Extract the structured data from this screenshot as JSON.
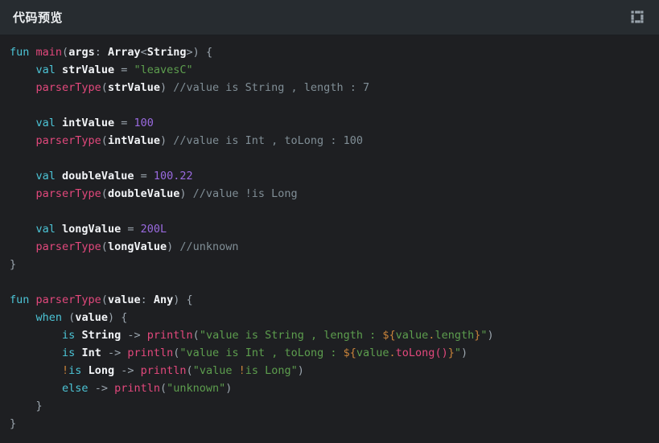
{
  "window": {
    "title": "代码预览",
    "fullscreen_button_label": "compress-arrows",
    "background_color": "#1e1f22",
    "header_background_color": "#272c30"
  },
  "editor": {
    "language": "Kotlin",
    "theme": "dark",
    "colors": {
      "keyword": "#4cc4d6",
      "function": "#e2487c",
      "identifier": "#f2f4f7",
      "number": "#9a6ae0",
      "string": "#5d9e4e",
      "comment": "#808e96",
      "punctuation": "#9aa4ad",
      "template": "#c8833a"
    },
    "lines": [
      "fun main(args: Array<String>) {",
      "    val strValue = \"leavesC\"",
      "    parserType(strValue) //value is String , length : 7",
      "",
      "    val intValue = 100",
      "    parserType(intValue) //value is Int , toLong : 100",
      "",
      "    val doubleValue = 100.22",
      "    parserType(doubleValue) //value !is Long",
      "",
      "    val longValue = 200L",
      "    parserType(longValue) //unknown",
      "}",
      "",
      "fun parserType(value: Any) {",
      "    when (value) {",
      "        is String -> println(\"value is String , length : ${value.length}\")",
      "        is Int -> println(\"value is Int , toLong : ${value.toLong()}\")",
      "        !is Long -> println(\"value !is Long\")",
      "        else -> println(\"unknown\")",
      "    }",
      "}"
    ],
    "tokens": {
      "keywords": [
        "fun",
        "val",
        "when",
        "is",
        "else"
      ],
      "functions": [
        "main",
        "parserType",
        "println",
        "toLong"
      ],
      "types": [
        "Array",
        "String",
        "Int",
        "Long",
        "Any"
      ],
      "identifiers": [
        "args",
        "strValue",
        "intValue",
        "doubleValue",
        "longValue",
        "value"
      ],
      "numbers": [
        "100",
        "100.22",
        "200L",
        "7"
      ],
      "strings": [
        "\"leavesC\"",
        "\"value is String , length : \"",
        "\"value is Int , toLong : \"",
        "\"value !is Long\"",
        "\"unknown\""
      ],
      "comments": [
        "//value is String , length : 7",
        "//value is Int , toLong : 100",
        "//value !is Long",
        "//unknown"
      ]
    }
  }
}
